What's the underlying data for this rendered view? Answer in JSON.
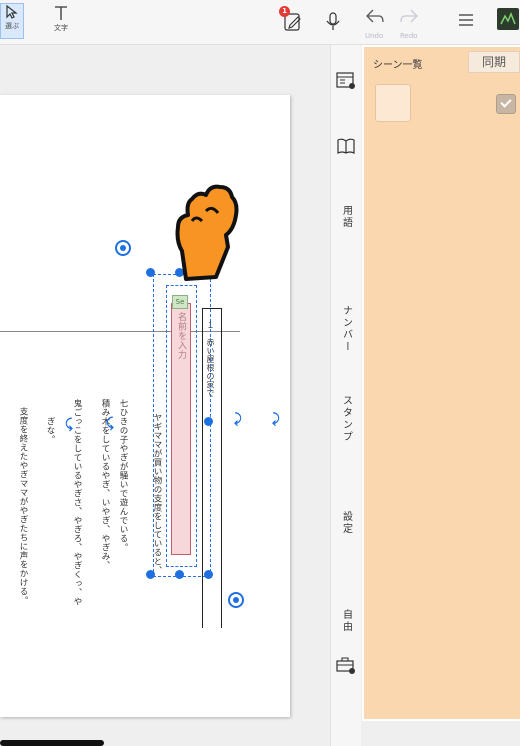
{
  "toolbar": {
    "select_label": "選ぶ",
    "text_label": "文字",
    "notification_count": "1",
    "undo_label": "Undo",
    "redo_label": "Redo"
  },
  "page": {
    "title_text": "１　赤い屋根の家で",
    "pink_box_text": "名前を入力",
    "sticker_text": "Se",
    "body_columns": [
      "ヤギママが買い物の支度をしていると、",
      "七ひきの子やぎが騒いで遊んでいる。",
      "積み木をしているやぎ、いやぎ、やぎみ、",
      "鬼ごっこをしているやぎさ、やぎろ、やぎくっ、や",
      "ぎな。",
      "支度を終えたやぎママがやぎたちに声をかける。"
    ]
  },
  "sidebar_tabs": [
    "用語",
    "ナンバー",
    "スタンプ",
    "設定",
    "自由"
  ],
  "panel": {
    "title": "シーン一覧",
    "sync_label": "同期"
  }
}
